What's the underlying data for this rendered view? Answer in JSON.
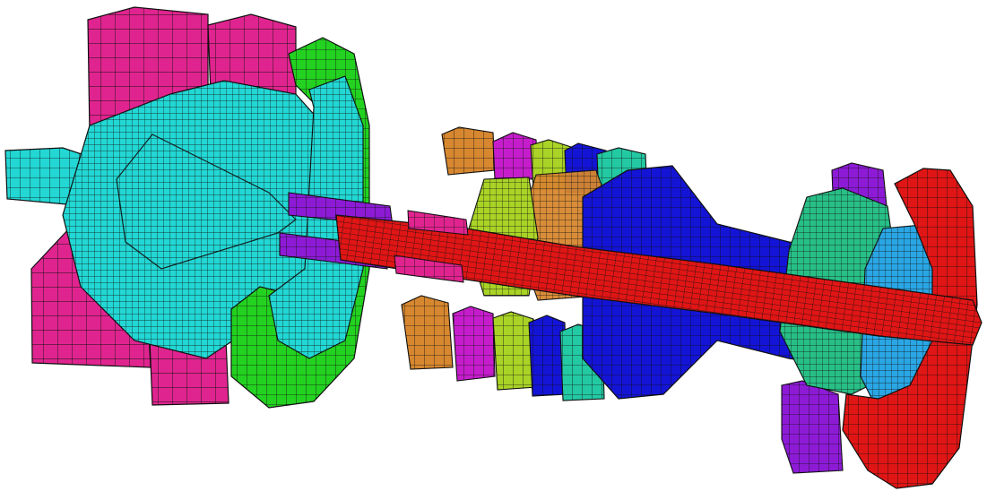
{
  "scene": {
    "part_colors": {
      "magenta_disk": "#e0248f",
      "cyan_housing": "#22d7d4",
      "green_disk": "#23d220",
      "purple_sleeve": "#8d1bd6",
      "red_shaft": "#e01515",
      "orange_disk": "#d7872f",
      "violet_disk": "#c61dcc",
      "yellow_green_disk": "#a9d326",
      "blue_shaft_casing": "#1414d6",
      "teal_disk": "#23c9a3",
      "light_blue_disk": "#2aa6e5",
      "sea_green_disk": "#28bf87",
      "mesh_line": "#101010"
    }
  }
}
